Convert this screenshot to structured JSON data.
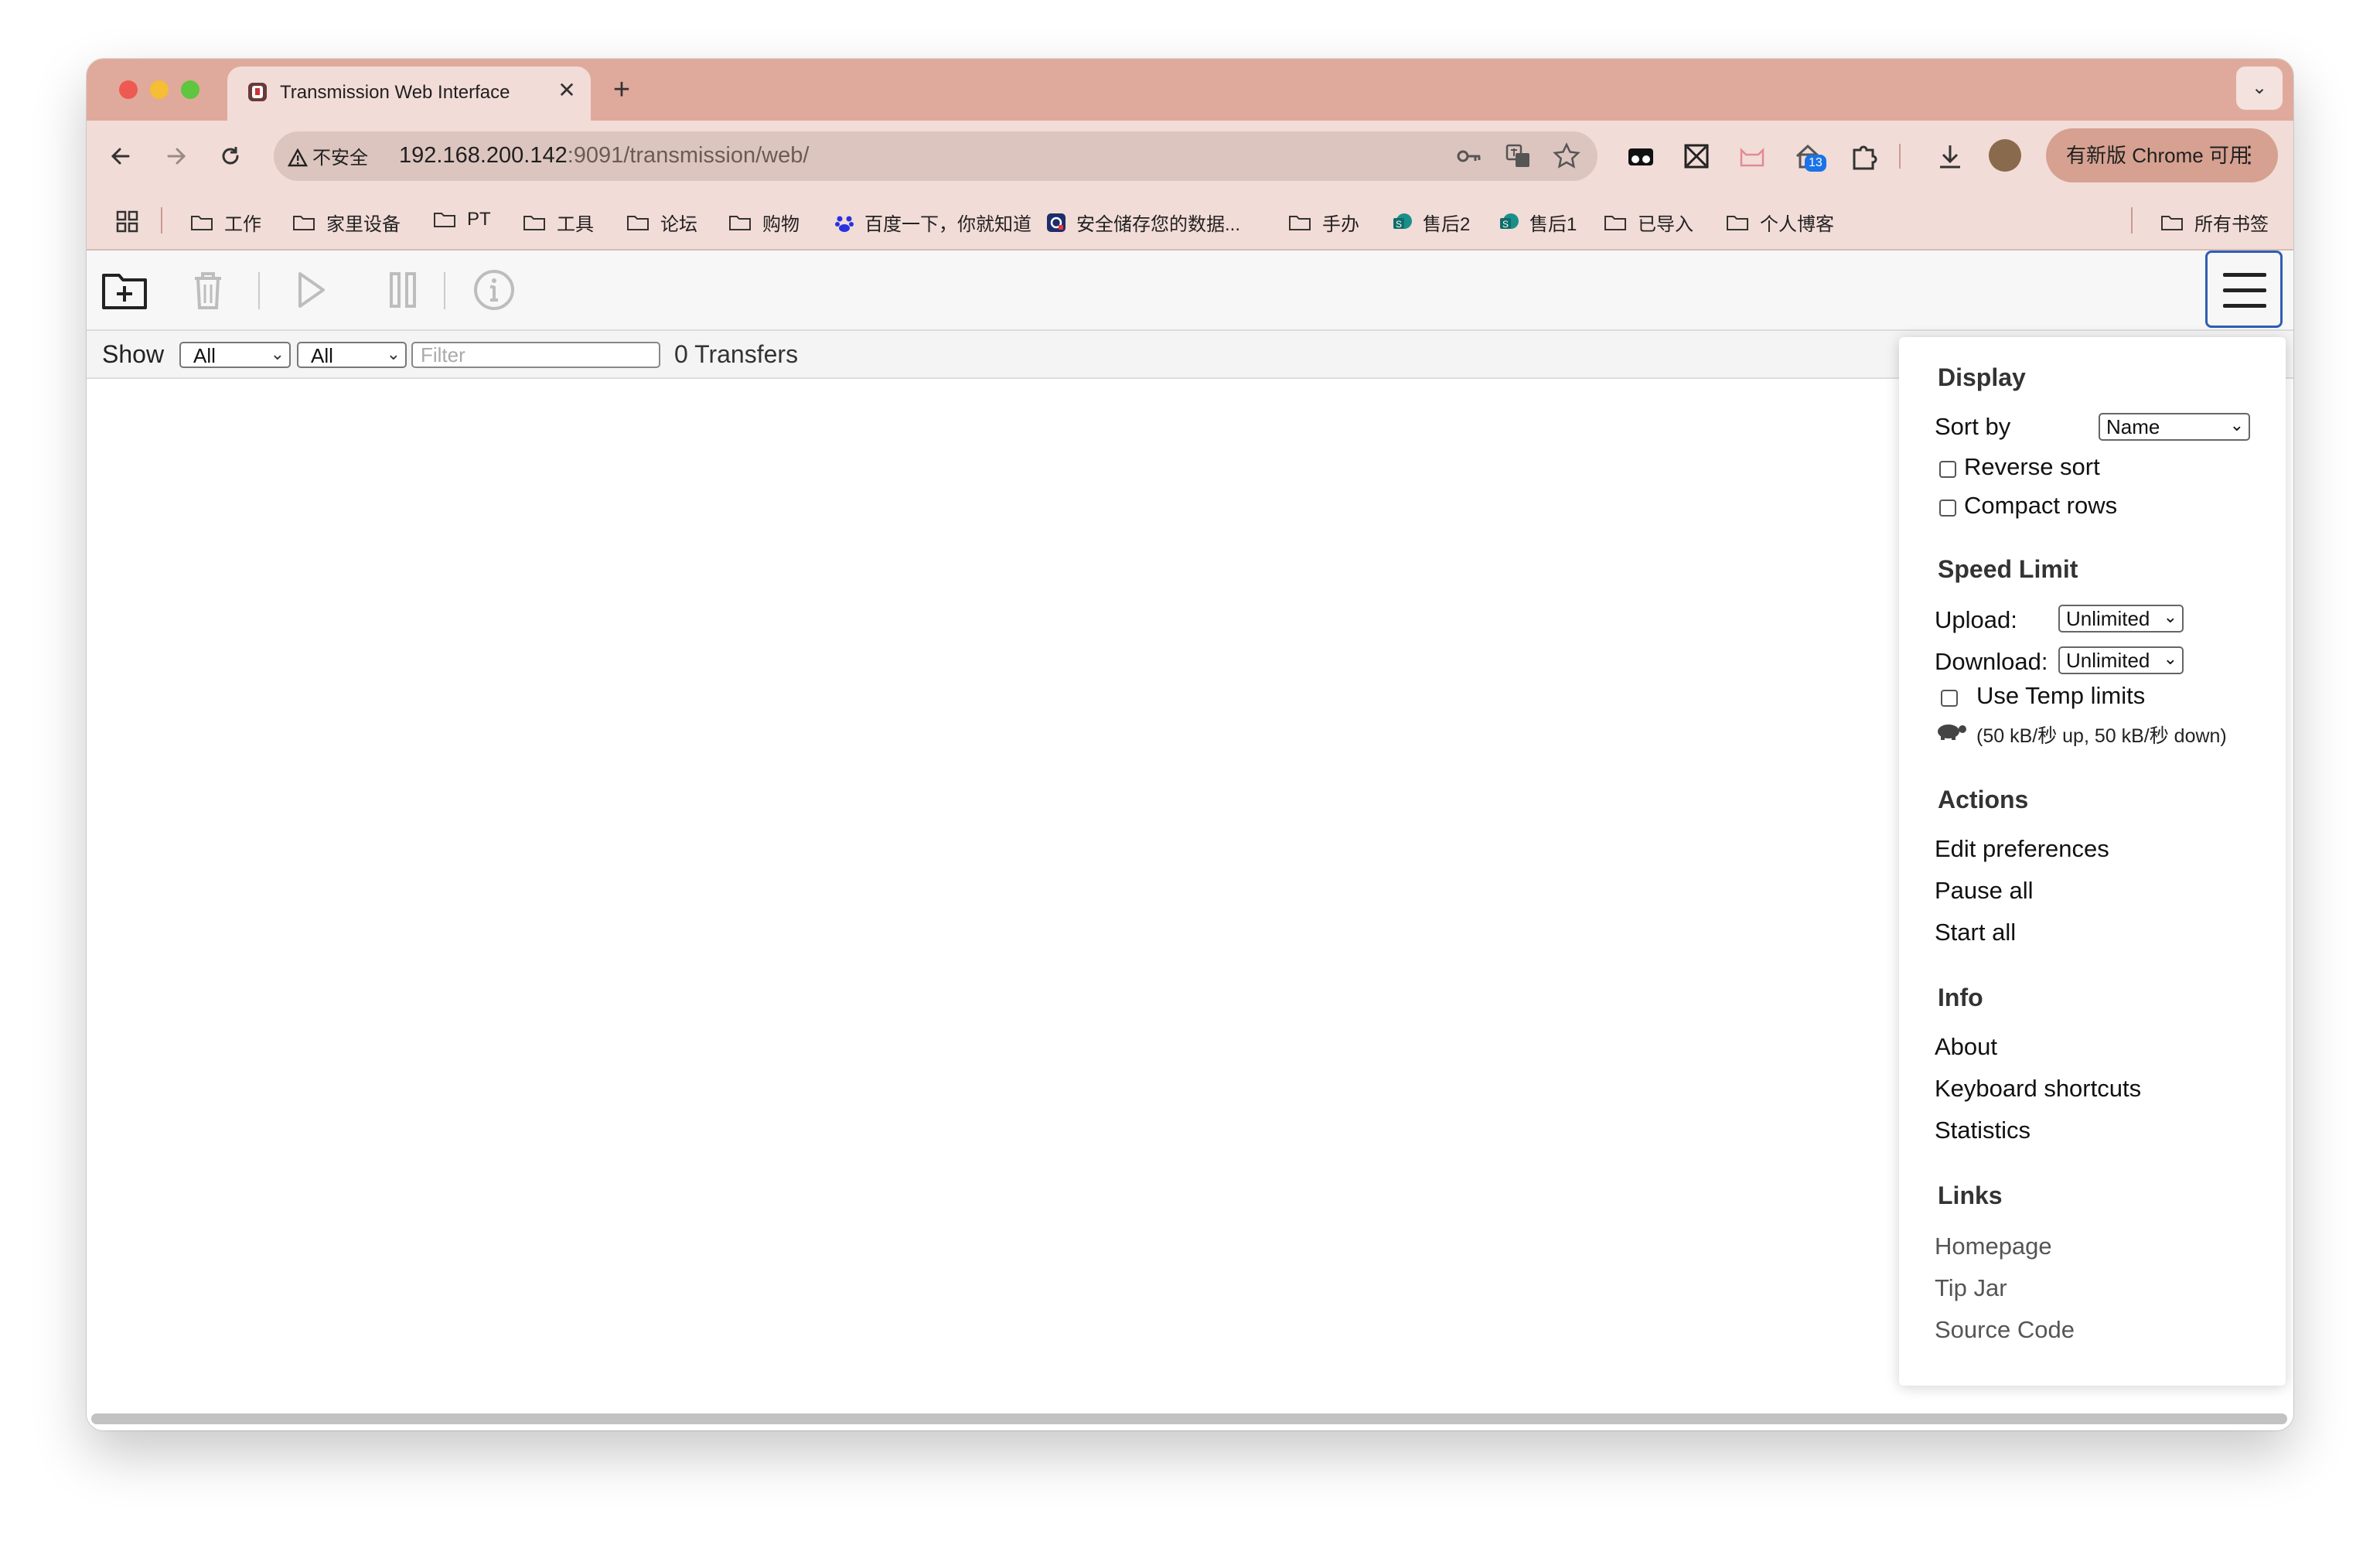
{
  "browser": {
    "tab_title": "Transmission Web Interface",
    "new_tab_symbol": "+",
    "tab_close_symbol": "✕",
    "tab_search_symbol": "⌄",
    "security_label": "不安全",
    "url_host": "192.168.200.142",
    "url_rest": ":9091/transmission/web/",
    "extension_badge": "13",
    "update_label": "有新版 Chrome 可用",
    "update_menu_symbol": "⋮"
  },
  "bookmarks": {
    "items": [
      {
        "label": "工作",
        "icon": "folder-icon"
      },
      {
        "label": "家里设备",
        "icon": "folder-icon"
      },
      {
        "label": "PT",
        "icon": "folder-icon"
      },
      {
        "label": "工具",
        "icon": "folder-icon"
      },
      {
        "label": "论坛",
        "icon": "folder-icon"
      },
      {
        "label": "购物",
        "icon": "folder-icon"
      },
      {
        "label": "百度一下，你就知道",
        "icon": "baidu-icon"
      },
      {
        "label": "安全储存您的数据...",
        "icon": "vault-icon"
      },
      {
        "label": "手办",
        "icon": "folder-icon"
      },
      {
        "label": "售后2",
        "icon": "sharepoint-icon"
      },
      {
        "label": "售后1",
        "icon": "sharepoint-icon"
      },
      {
        "label": "已导入",
        "icon": "folder-icon"
      },
      {
        "label": "个人博客",
        "icon": "folder-icon"
      }
    ],
    "all_bookmarks": "所有书签"
  },
  "transmission": {
    "filter": {
      "show_label": "Show",
      "state_value": "All",
      "tracker_value": "All",
      "filter_placeholder": "Filter",
      "transfers_count": "0 Transfers"
    },
    "menu": {
      "display_heading": "Display",
      "sort_by_label": "Sort by",
      "sort_by_value": "Name",
      "reverse_sort": "Reverse sort",
      "compact_rows": "Compact rows",
      "speed_heading": "Speed Limit",
      "upload_label": "Upload:",
      "upload_value": "Unlimited",
      "download_label": "Download:",
      "download_value": "Unlimited",
      "temp_limits": "Use Temp limits",
      "temp_limits_detail": "(50 kB/秒 up, 50 kB/秒 down)",
      "actions_heading": "Actions",
      "edit_preferences": "Edit preferences",
      "pause_all": "Pause all",
      "start_all": "Start all",
      "info_heading": "Info",
      "about": "About",
      "keyboard_shortcuts": "Keyboard shortcuts",
      "statistics": "Statistics",
      "links_heading": "Links",
      "homepage": "Homepage",
      "tip_jar": "Tip Jar",
      "source_code": "Source Code"
    }
  },
  "colors": {
    "tabstrip": "#dfaa9c",
    "toolbar": "#f2dcd7",
    "accent_focus": "#2f5eb4"
  }
}
